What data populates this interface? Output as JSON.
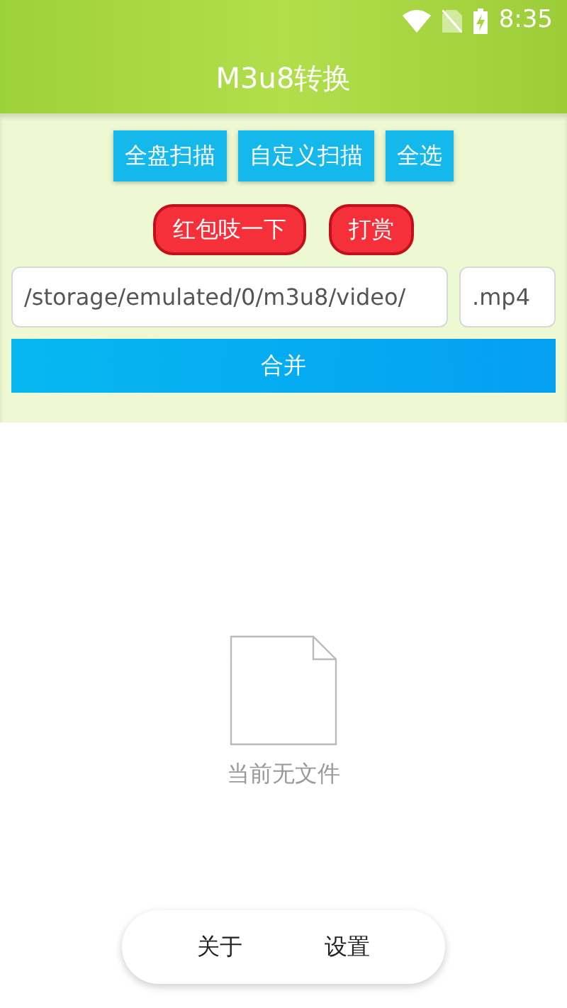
{
  "status_bar": {
    "time": "8:35"
  },
  "app_bar": {
    "title": "M3u8转换"
  },
  "scan_buttons": [
    {
      "label": "全盘扫描"
    },
    {
      "label": "自定义扫描"
    },
    {
      "label": "全选"
    }
  ],
  "reward_buttons": [
    {
      "label": "红包吱一下"
    },
    {
      "label": "打赏"
    }
  ],
  "path_field": {
    "value": "/storage/emulated/0/m3u8/video/"
  },
  "extension_field": {
    "value": ".mp4"
  },
  "merge_button": {
    "label": "合并"
  },
  "empty_state": {
    "text": "当前无文件"
  },
  "bottom_nav": [
    {
      "label": "关于"
    },
    {
      "label": "设置"
    }
  ]
}
